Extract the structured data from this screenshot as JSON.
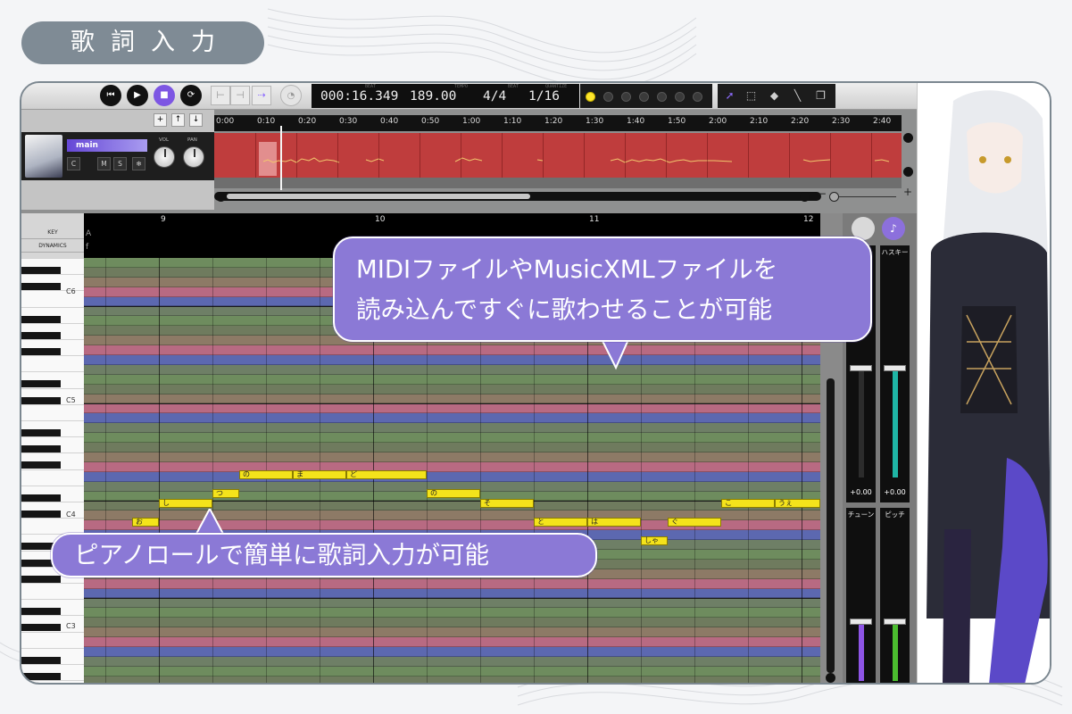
{
  "page_title": "歌詞入力",
  "transport": {
    "time": "000:16.349",
    "tempo": "189.00",
    "beat": "4/4",
    "quantize": "1/16",
    "time_caption": "BEAT",
    "tempo_caption": "TEMPO",
    "beat_caption": "BEAT",
    "quantize_caption": "QUANTIZE"
  },
  "timeline": {
    "ticks": [
      "0:00",
      "0:10",
      "0:20",
      "0:30",
      "0:40",
      "0:50",
      "1:00",
      "1:10",
      "1:20",
      "1:30",
      "1:40",
      "1:50",
      "2:00",
      "2:10",
      "2:20",
      "2:30",
      "2:40"
    ]
  },
  "track": {
    "name": "main",
    "buttons": [
      "C",
      "M",
      "S",
      "❄"
    ],
    "vol_label": "VOL",
    "pan_label": "PAN"
  },
  "header_buttons": [
    "+",
    "↑",
    "↓"
  ],
  "zoom": {
    "minus": "−",
    "plus": "+"
  },
  "piano_roll": {
    "row_labels": {
      "key": "KEY",
      "dynamics": "DYNAMICS"
    },
    "bar_numbers": [
      "9",
      "10",
      "11",
      "12"
    ],
    "octave_labels": [
      "C6",
      "C5",
      "C4",
      "C3"
    ],
    "key_value": "A",
    "dynamics_value": "f",
    "lyrics": [
      "お",
      "し",
      "つ",
      "の",
      "ま",
      "ど",
      "の",
      "そ",
      "と",
      "は",
      "しゃ",
      "ぐ",
      "こ",
      "うぇ"
    ]
  },
  "mixer": {
    "fader1_label": "",
    "fader2_label": "ハスキー",
    "fader1_value": "+0.00",
    "fader2_value": "+0.00",
    "fader3_label": "チューン",
    "fader4_label": "ピッチ",
    "fader2_color": "#1fb5a5",
    "fader3_color": "#8e55e6",
    "fader4_color": "#4bbd2f"
  },
  "callouts": {
    "top_line1": "MIDIファイルやMusicXMLファイルを",
    "top_line2": "読み込んですぐに歌わせることが可能",
    "bottom": "ピアノロールで簡単に歌詞入力が可能"
  },
  "colors": {
    "accent": "#8b79d6",
    "track_wave": "#bf3d3d",
    "note": "#f4e31b",
    "title_pill": "#7f8b95"
  }
}
